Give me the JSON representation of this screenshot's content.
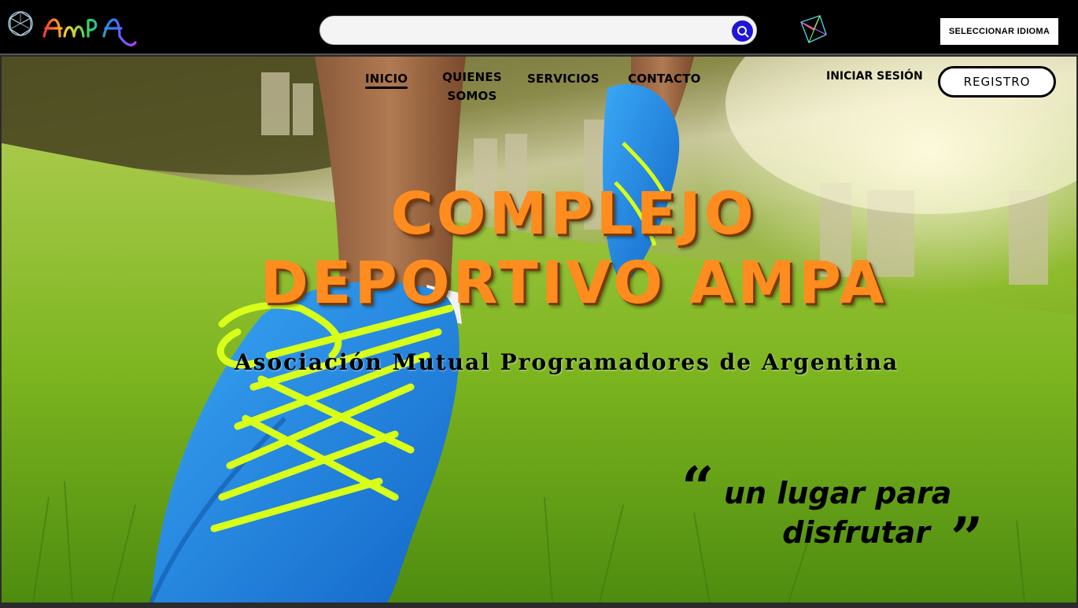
{
  "header": {
    "brand_icon": "geodesic-sphere-icon",
    "brand_logo": "ampa-handwritten-logo",
    "search": {
      "value": "",
      "placeholder": "",
      "icon": "search-icon"
    },
    "decor_icon": "wireframe-gem-icon",
    "language_button": "SELECCIONAR IDIOMA"
  },
  "nav": {
    "items": [
      {
        "label": "INICIO",
        "active": true
      },
      {
        "label": "QUIENES SOMOS",
        "lines": [
          "QUIENES",
          "SOMOS"
        ]
      },
      {
        "label": "SERVICIOS"
      },
      {
        "label": "CONTACTO"
      }
    ],
    "login": "INICIAR SESIÓN",
    "register": "REGISTRO"
  },
  "hero": {
    "title_line1": "COMPLEJO",
    "title_line2": "DEPORTIVO AMPA",
    "subtitle": "Asociación Mutual Programadores de Argentina",
    "quote_open": "“",
    "quote_line1": "un lugar para",
    "quote_line2": "disfrutar",
    "quote_close": "”"
  },
  "colors": {
    "topbar": "#000000",
    "accent_title": "#ff8c1e",
    "search_button": "#1d15d8",
    "shoe_blue": "#1e90e6",
    "laces": "#d8ff1a"
  }
}
